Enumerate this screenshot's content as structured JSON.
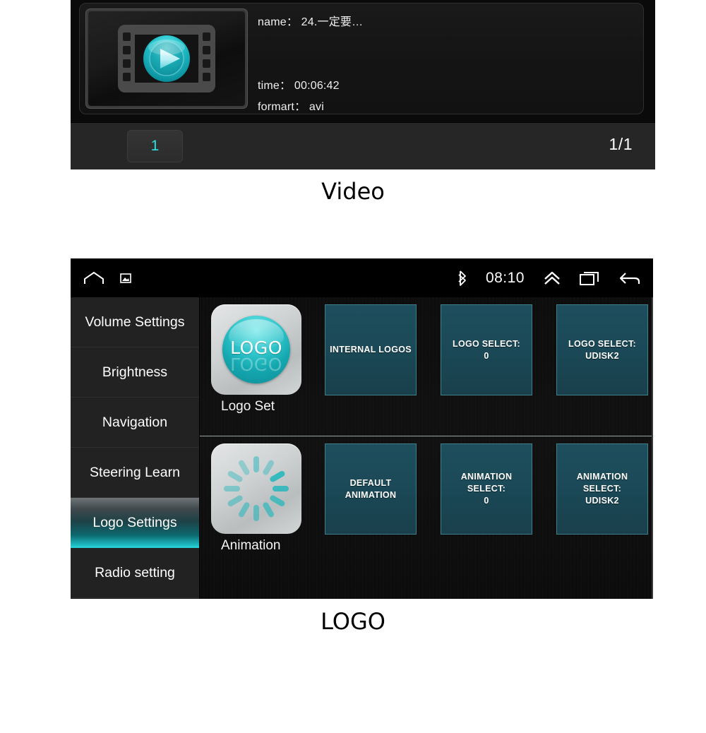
{
  "video_panel": {
    "item": {
      "thumbnail_icon": "film-strip-play-icon",
      "name_label": "name：",
      "name_value": "24.一定要…",
      "name_full": "name： 24.一定要…",
      "time_label": "time：",
      "time_value": "00:06:42",
      "time_full": "time： 00:06:42",
      "format_label": "formart：",
      "format_value": "avi",
      "format_full": "formart： avi"
    },
    "footer": {
      "page_button": "1",
      "page_count": "1/1",
      "accent_color": "#2ae0e0"
    }
  },
  "captions": {
    "video": "Video",
    "logo": "LOGO"
  },
  "logo_panel": {
    "status_bar": {
      "home_icon": "home-icon",
      "screenshot_icon": "screenshot-icon",
      "bluetooth_icon": "bluetooth-icon",
      "clock": "08:10",
      "chevron_up_icon": "chevron-double-up-icon",
      "recents_icon": "recent-apps-icon",
      "back_icon": "back-arrow-icon"
    },
    "sidebar": {
      "items": [
        {
          "label": "Volume Settings",
          "selected": false
        },
        {
          "label": "Brightness",
          "selected": false
        },
        {
          "label": "Navigation",
          "selected": false
        },
        {
          "label": "Steering Learn",
          "selected": false
        },
        {
          "label": "Logo Settings",
          "selected": true
        },
        {
          "label": "Radio setting",
          "selected": false
        }
      ],
      "selected_accent": "#1ec3c9"
    },
    "rows": [
      {
        "app_icon": "logo-sphere-icon",
        "app_icon_text": "LOGO",
        "app_label": "Logo Set",
        "tiles": [
          {
            "text": "INTERNAL LOGOS"
          },
          {
            "text": "LOGO SELECT:\n0"
          },
          {
            "text": "LOGO SELECT:\nUDISK2"
          }
        ]
      },
      {
        "app_icon": "loading-spinner-icon",
        "app_icon_text": "",
        "app_label": "Animation",
        "tiles": [
          {
            "text": "DEFAULT\nANIMATION"
          },
          {
            "text": "ANIMATION\nSELECT:\n0"
          },
          {
            "text": "ANIMATION\nSELECT:\nUDISK2"
          }
        ]
      }
    ],
    "tile_colors": {
      "fill": "#1b4957",
      "border": "#3f7f8c"
    }
  }
}
